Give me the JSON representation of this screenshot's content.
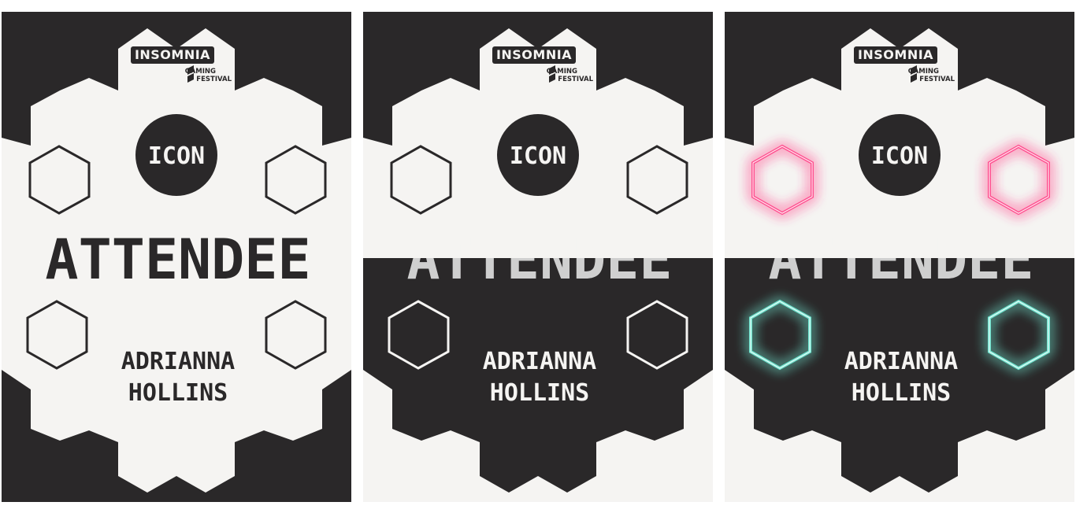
{
  "colors": {
    "dark": "#2a2829",
    "light": "#f5f4f2",
    "grey_text": "#cfcfcf",
    "neon_pink": "#ff4f8f",
    "neon_teal": "#6fe4cf"
  },
  "logo": {
    "brand": "INSOMNIA",
    "line1": "GAMING",
    "line2": "FESTIVAL"
  },
  "badges": [
    {
      "variant": "plain",
      "icon_label": "ICON",
      "role": "ATTENDEE",
      "first_name": "ADRIANNA",
      "last_name": "HOLLINS",
      "hexagon_icons": [
        "hexagon-outline-icon",
        "hexagon-outline-icon",
        "hexagon-outline-icon",
        "hexagon-outline-icon"
      ]
    },
    {
      "variant": "split",
      "icon_label": "ICON",
      "role": "ATTENDEE",
      "first_name": "ADRIANNA",
      "last_name": "HOLLINS",
      "hexagon_icons": [
        "hexagon-outline-icon",
        "hexagon-outline-icon",
        "hexagon-outline-icon",
        "hexagon-outline-icon"
      ]
    },
    {
      "variant": "neon",
      "icon_label": "ICON",
      "role": "ATTENDEE",
      "first_name": "ADRIANNA",
      "last_name": "HOLLINS",
      "hexagon_icons": [
        "neon-pink-hexagon-icon",
        "neon-pink-hexagon-icon",
        "neon-teal-hexagon-icon",
        "neon-teal-hexagon-icon"
      ]
    }
  ]
}
